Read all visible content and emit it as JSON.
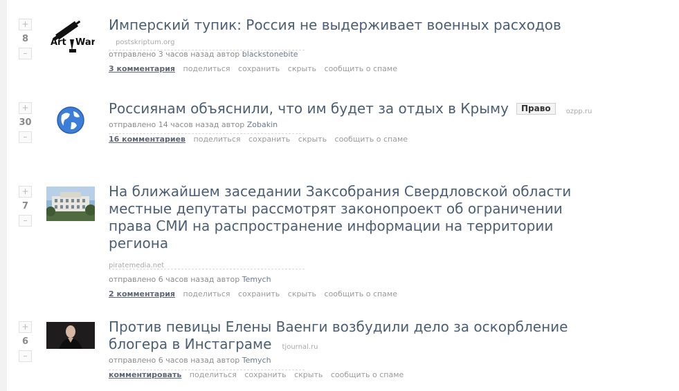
{
  "posts": [
    {
      "score": "8",
      "title": "Имперский тупик: Россия не выдерживает военных расходов",
      "domain": "postskriptum.org",
      "submitted": "отправлено 3 часов назад автор",
      "author": "blackstonebite",
      "comments": "3 комментария",
      "thumb": "art-of-war-logo"
    },
    {
      "score": "30",
      "title": "Россиянам объяснили, что им будет за отдых в Крыму",
      "tag": "Право",
      "domain": "ozpp.ru",
      "submitted": "отправлено 14 часов назад автор",
      "author": "Zobakin",
      "comments": "16 комментариев",
      "thumb": "globe-icon"
    },
    {
      "score": "7",
      "title": "На ближайшем заседании Заксобрания Свердловской области местные депутаты рассмотрят законопроект об ограничении права СМИ на распространение информации на территории региона",
      "domain": "piratemedia.net",
      "submitted": "отправлено 6 часов назад автор",
      "author": "Temych",
      "comments": "2 комментария",
      "thumb": "building-photo"
    },
    {
      "score": "6",
      "title": "Против певицы Елены Ваенги возбудили дело за оскорбление блогера в Инстаграме",
      "domain": "tjournal.ru",
      "submitted": "отправлено 6 часов назад автор",
      "author": "Temych",
      "comments": "комментировать",
      "thumb": "singer-photo"
    }
  ],
  "actions": {
    "upvote": "+",
    "downvote": "–",
    "share": "поделиться",
    "save": "сохранить",
    "hide": "скрыть",
    "report": "сообщить о спаме"
  },
  "colors": {
    "title": "#4b5e74",
    "meta": "#8a8a8a",
    "domain": "#a9a9a9"
  }
}
